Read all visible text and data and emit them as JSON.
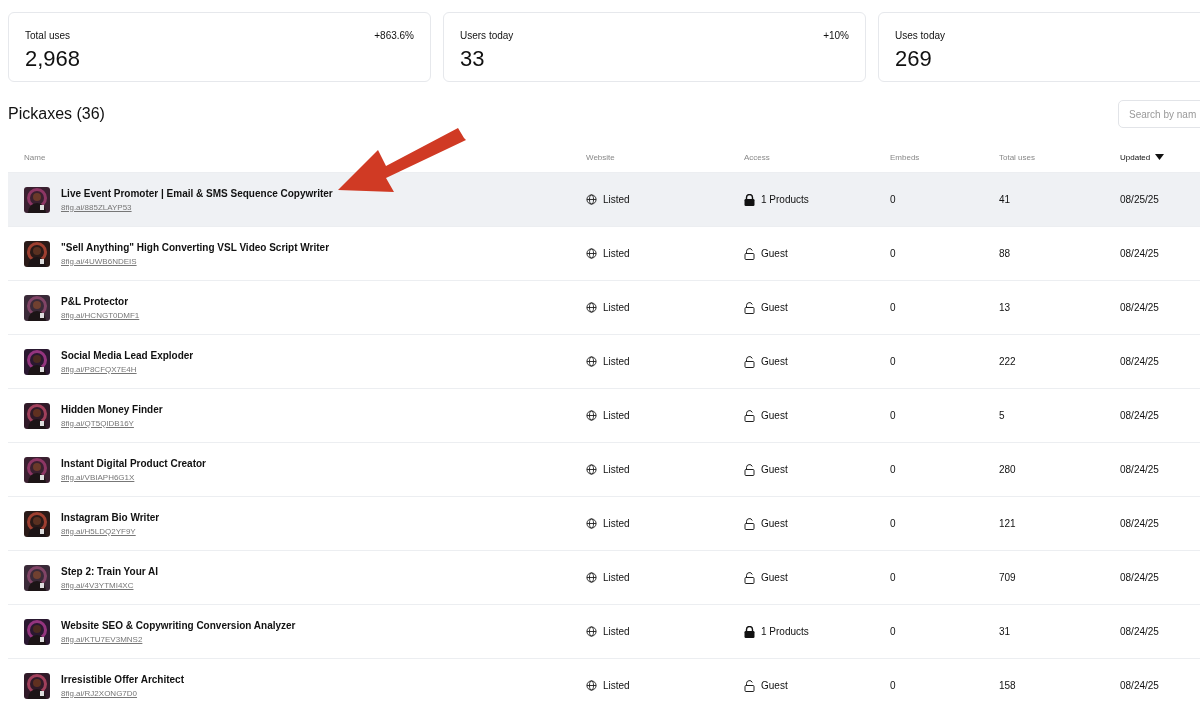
{
  "stats": [
    {
      "label": "Total uses",
      "value": "2,968",
      "change": "+863.6%"
    },
    {
      "label": "Users today",
      "value": "33",
      "change": "+10%"
    },
    {
      "label": "Uses today",
      "value": "269"
    }
  ],
  "section": {
    "title": "Pickaxes (36)",
    "search": {
      "placeholder": "Search by nam"
    }
  },
  "table": {
    "columns": [
      {
        "label": "Name",
        "sorted": false
      },
      {
        "label": "Website",
        "sorted": false
      },
      {
        "label": "Access",
        "sorted": false
      },
      {
        "label": "Embeds",
        "sorted": false
      },
      {
        "label": "Total uses",
        "sorted": false
      },
      {
        "label": "Updated",
        "sorted": true
      }
    ],
    "rows": [
      {
        "name": "Live Event Promoter | Email & SMS Sequence Copywriter",
        "link": "8fig.ai/885ZLAYP53",
        "website": "Listed",
        "access": "1 Products",
        "locked": true,
        "embeds": "0",
        "total_uses": "41",
        "updated": "08/25/25",
        "highlighted": true
      },
      {
        "name": "\"Sell Anything\" High Converting VSL Video Script Writer",
        "link": "8fig.ai/4UWB6NDEIS",
        "website": "Listed",
        "access": "Guest",
        "locked": false,
        "embeds": "0",
        "total_uses": "88",
        "updated": "08/24/25",
        "highlighted": false
      },
      {
        "name": "P&L Protector",
        "link": "8fig.ai/HCNGT0DMF1",
        "website": "Listed",
        "access": "Guest",
        "locked": false,
        "embeds": "0",
        "total_uses": "13",
        "updated": "08/24/25",
        "highlighted": false
      },
      {
        "name": "Social Media Lead Exploder",
        "link": "8fig.ai/P8CFQX7E4H",
        "website": "Listed",
        "access": "Guest",
        "locked": false,
        "embeds": "0",
        "total_uses": "222",
        "updated": "08/24/25",
        "highlighted": false
      },
      {
        "name": "Hidden Money Finder",
        "link": "8fig.ai/QT5QIDB16Y",
        "website": "Listed",
        "access": "Guest",
        "locked": false,
        "embeds": "0",
        "total_uses": "5",
        "updated": "08/24/25",
        "highlighted": false
      },
      {
        "name": "Instant Digital Product Creator",
        "link": "8fig.ai/VBIAPH6G1X",
        "website": "Listed",
        "access": "Guest",
        "locked": false,
        "embeds": "0",
        "total_uses": "280",
        "updated": "08/24/25",
        "highlighted": false
      },
      {
        "name": "Instagram Bio Writer",
        "link": "8fig.ai/H5LDQ2YF9Y",
        "website": "Listed",
        "access": "Guest",
        "locked": false,
        "embeds": "0",
        "total_uses": "121",
        "updated": "08/24/25",
        "highlighted": false
      },
      {
        "name": "Step 2: Train Your AI",
        "link": "8fig.ai/4V3YTMI4XC",
        "website": "Listed",
        "access": "Guest",
        "locked": false,
        "embeds": "0",
        "total_uses": "709",
        "updated": "08/24/25",
        "highlighted": false
      },
      {
        "name": "Website SEO & Copywriting Conversion Analyzer",
        "link": "8fig.ai/KTU7EV3MNS2",
        "website": "Listed",
        "access": "1 Products",
        "locked": true,
        "embeds": "0",
        "total_uses": "31",
        "updated": "08/24/25",
        "highlighted": false
      },
      {
        "name": "Irresistible Offer Architect",
        "link": "8fig.ai/RJ2XONG7D0",
        "website": "Listed",
        "access": "Guest",
        "locked": false,
        "embeds": "0",
        "total_uses": "158",
        "updated": "08/24/25",
        "highlighted": false
      }
    ]
  }
}
